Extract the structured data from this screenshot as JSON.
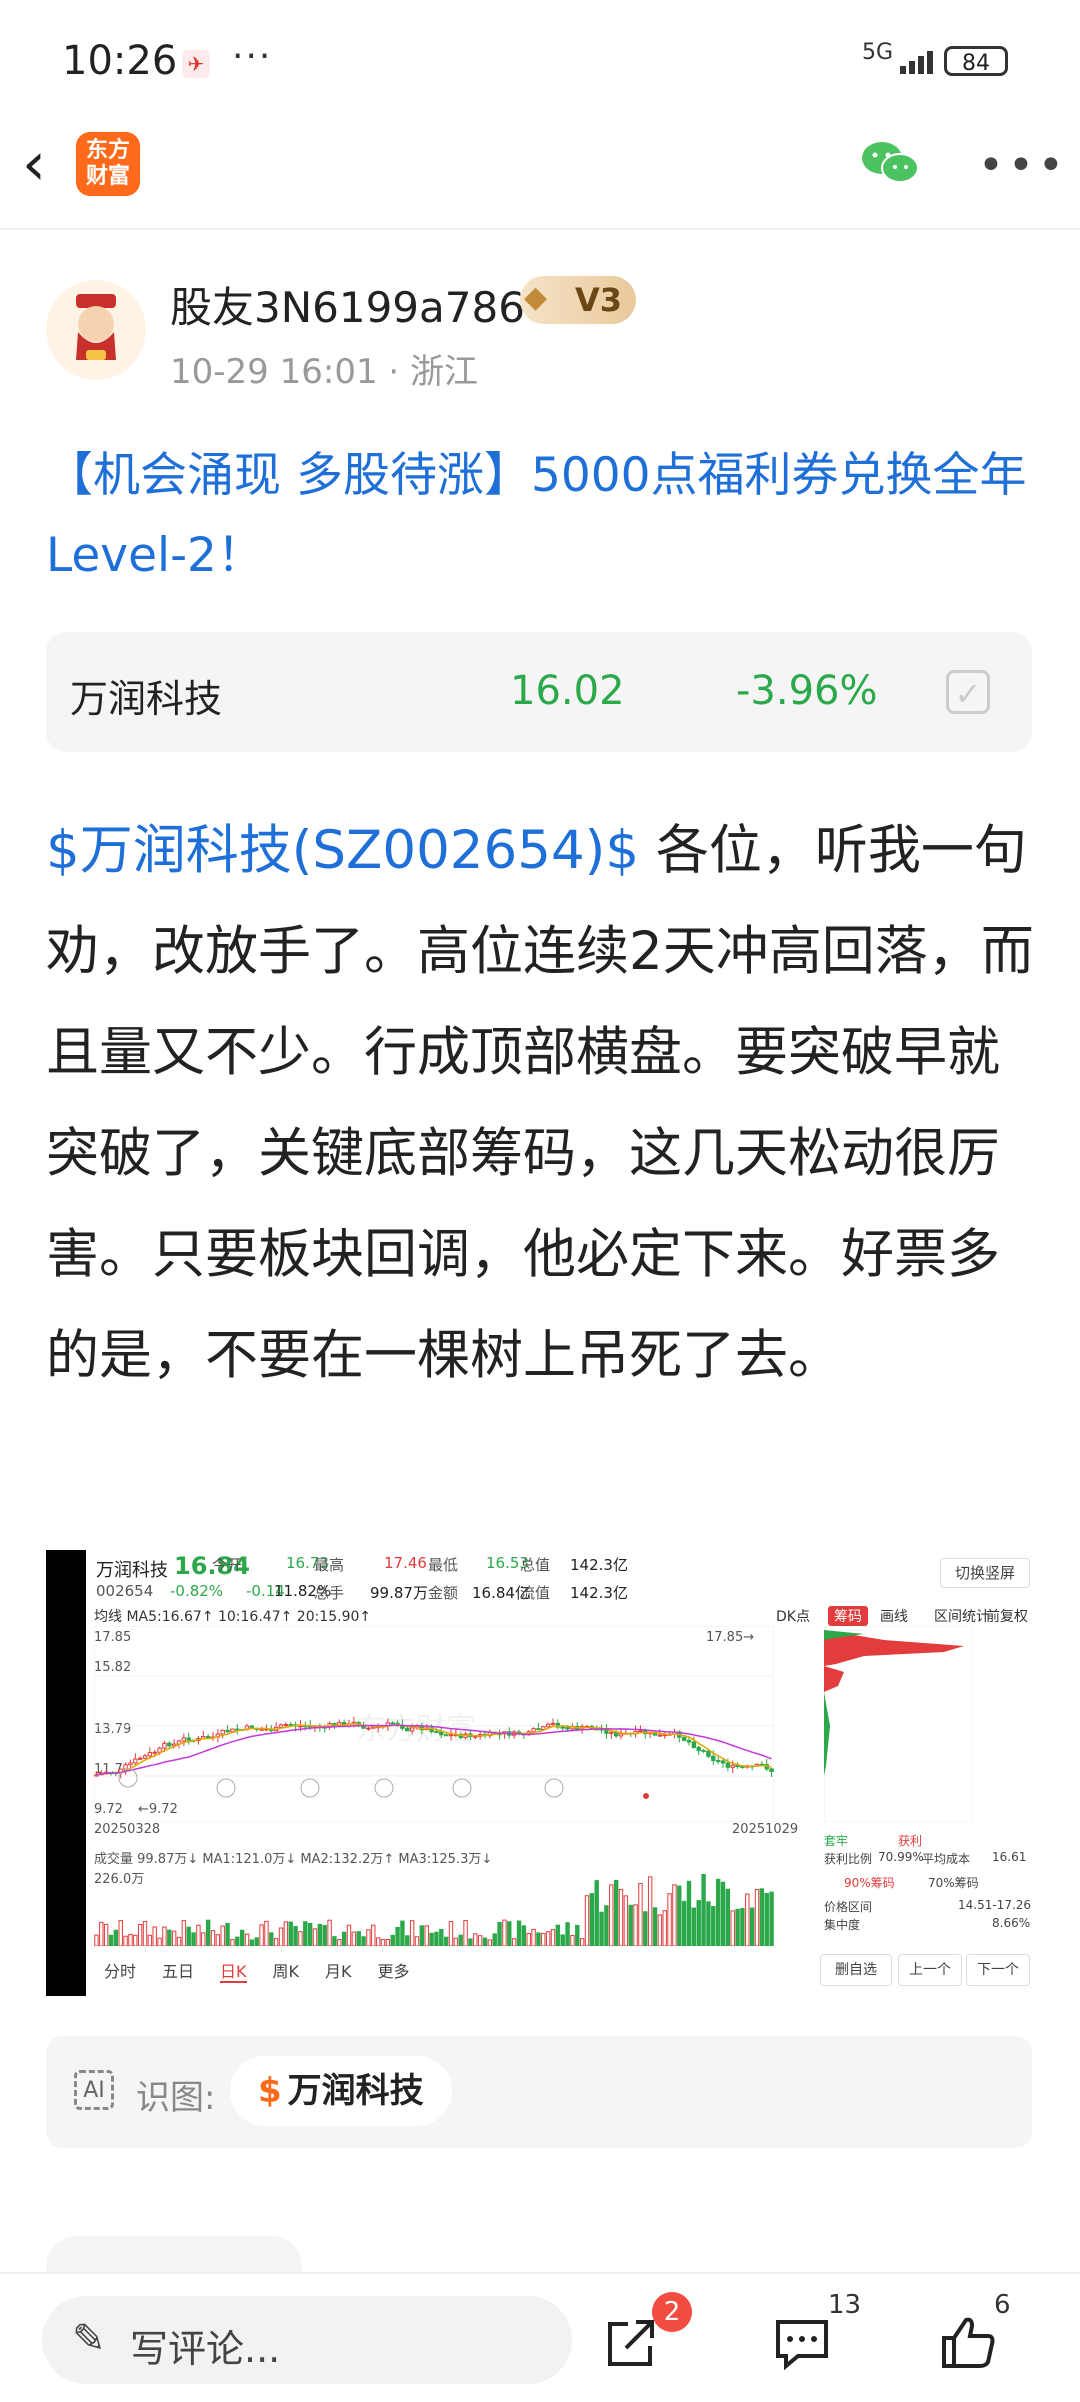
{
  "status": {
    "time": "10:26",
    "network": "5G",
    "battery": "84"
  },
  "header": {
    "logo_text_1": "东方",
    "logo_text_2": "财富"
  },
  "author": {
    "name": "股友3N6199a786",
    "level": "V3",
    "meta": "10-29 16:01 · 浙江"
  },
  "post": {
    "title": "【机会涌现 多股待涨】5000点福利券兑换全年Level-2！",
    "stock_tag": "$万润科技(SZ002654)$",
    "body": " 各位，听我一句劝，改放手了。高位连续2天冲高回落，而且量又不少。行成顶部横盘。要突破早就突破了，关键底部筹码，这几天松动很厉害。只要板块回调，他必定下来。好票多的是，不要在一棵树上吊死了去。"
  },
  "stock_card": {
    "name": "万润科技",
    "price": "16.02",
    "change_pct": "-3.96%"
  },
  "screenshot": {
    "name": "万润科技",
    "price": "16.84",
    "code": "002654",
    "change_pct": "-0.82%",
    "change": "-0.14",
    "open_lbl": "今开",
    "open": "16.73",
    "high_lbl": "最高",
    "high": "17.46",
    "low_lbl": "最低",
    "low": "16.53",
    "cap_lbl": "总值",
    "cap": "142.3亿",
    "turnover_lbl": "换手",
    "turnover": "11.82%",
    "hands_lbl": "总手",
    "hands": "99.87万",
    "amount_lbl": "金额",
    "amount": "16.84亿",
    "float_lbl": "流值",
    "float": "142.3亿",
    "switch": "切换竖屏",
    "ma_line": "均线 MA5:16.67↑ 10:16.47↑ 20:15.90↑",
    "dk": "DK点",
    "chouma": "筹码",
    "huaxian": "画线",
    "qujian": "区间统计",
    "fuquan": "前复权",
    "y_high": "17.85",
    "y_mid": "15.82",
    "y_mid2": "13.79",
    "y_mid3": "11.7",
    "y_low": "9.72",
    "peak_label": "17.85→",
    "low_label": "←9.72",
    "date_start": "20250328",
    "date_end": "20251029",
    "vol_line": "成交量 99.87万↓ MA1:121.0万↓ MA2:132.2万↑ MA3:125.3万↓",
    "vol_axis": "226.0万",
    "tabs": [
      "分时",
      "五日",
      "日K",
      "周K",
      "月K",
      "更多"
    ],
    "legend_trap": "套牢",
    "legend_profit": "获利",
    "profit_ratio_lbl": "获利比例",
    "profit_ratio": "70.99%",
    "avg_cost_lbl": "平均成本",
    "avg_cost": "16.61",
    "chip90": "90%筹码",
    "chip70": "70%筹码",
    "range_lbl": "价格区间",
    "range": "14.51-17.26",
    "conc_lbl": "集中度",
    "conc": "8.66%",
    "btn_del": "删自选",
    "btn_prev": "上一个",
    "btn_next": "下一个",
    "watermark": "东方财富"
  },
  "ai": {
    "label": "识图:",
    "chip": "万润科技"
  },
  "bottom": {
    "placeholder": "写评论...",
    "share_badge": "2",
    "comments": "13",
    "likes": "6"
  },
  "colors": {
    "up": "#e23c3c",
    "down": "#2aa84a",
    "link": "#1f6fd8",
    "brand": "#ff6a1a"
  }
}
